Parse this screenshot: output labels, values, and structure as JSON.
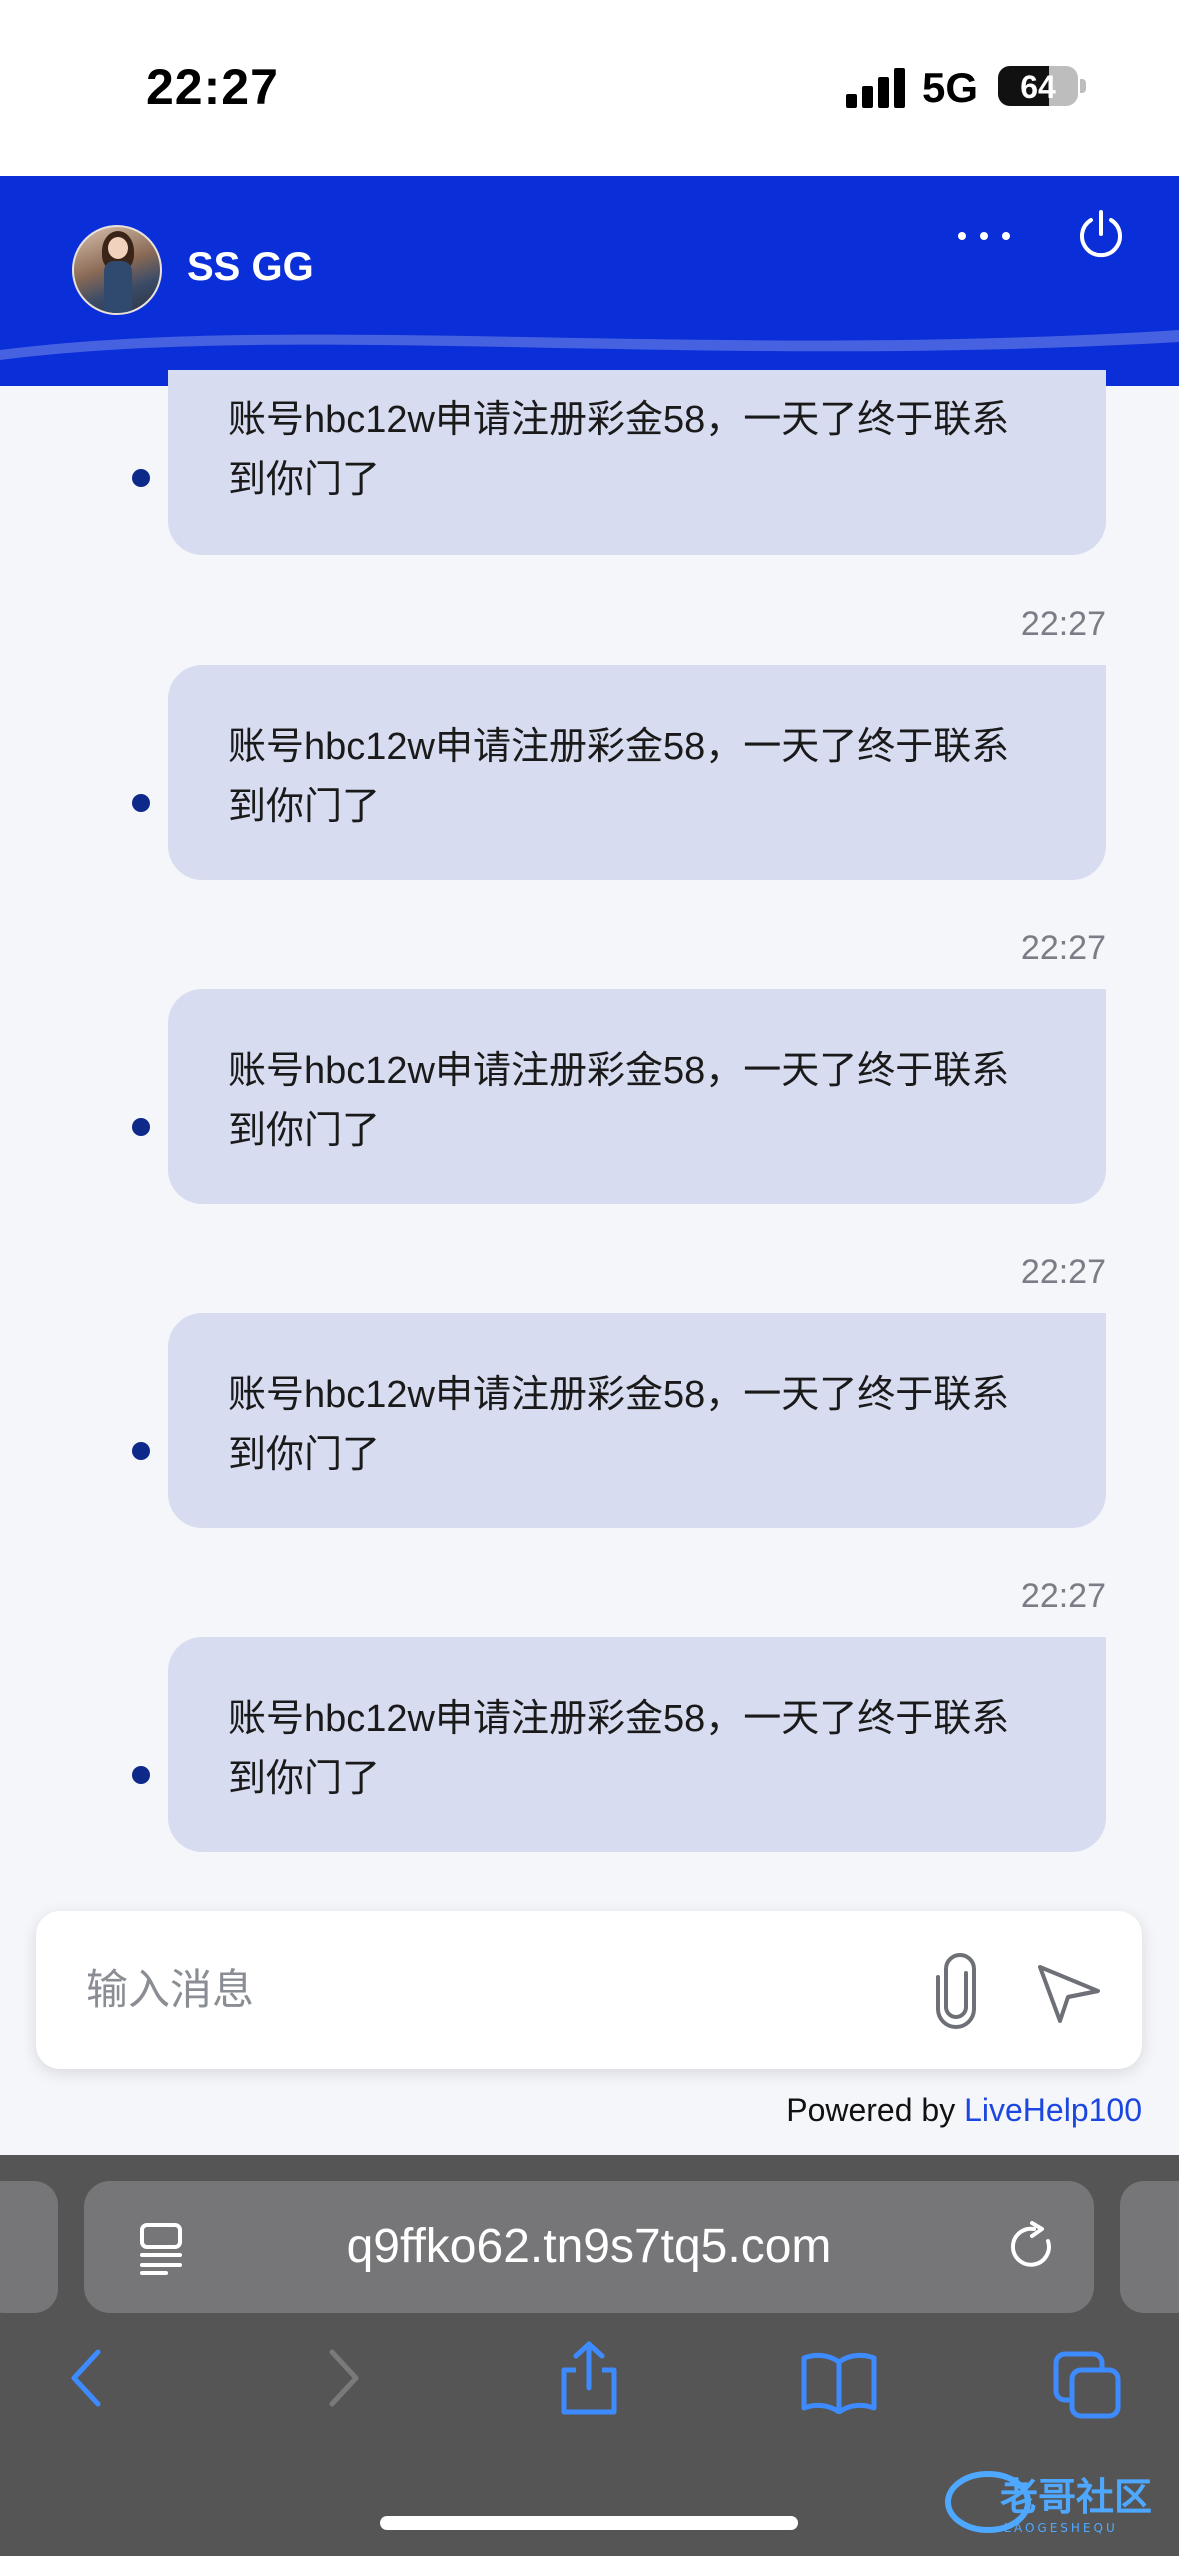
{
  "status_bar": {
    "time": "22:27",
    "network": "5G",
    "battery": "64",
    "battery_level": 0.64
  },
  "header": {
    "name": "SS GG",
    "avatar_icon": "user-avatar",
    "more_icon": "more-horizontal-icon",
    "power_icon": "power-icon",
    "color": "#0a2fd8"
  },
  "messages": [
    {
      "text": "账号hbc12w申请注册彩金58，一天了终于联系到你门了",
      "time": ""
    },
    {
      "text": "账号hbc12w申请注册彩金58，一天了终于联系到你门了",
      "time": "22:27"
    },
    {
      "text": "账号hbc12w申请注册彩金58，一天了终于联系到你门了",
      "time": "22:27"
    },
    {
      "text": "账号hbc12w申请注册彩金58，一天了终于联系到你门了",
      "time": "22:27"
    },
    {
      "text": "账号hbc12w申请注册彩金58，一天了终于联系到你门了",
      "time": "22:27"
    }
  ],
  "composer": {
    "placeholder": "输入消息",
    "attach_icon": "paperclip-icon",
    "send_icon": "send-icon"
  },
  "footer": {
    "powered_prefix": "Powered by ",
    "powered_link": "LiveHelp100"
  },
  "browser": {
    "url": "q9ffko62.tn9s7tq5.com",
    "icons": [
      "reader-icon",
      "reload-icon",
      "back-icon",
      "forward-icon",
      "share-icon",
      "bookmarks-icon",
      "tabs-icon"
    ]
  },
  "watermark": {
    "text": "老哥社区",
    "subtext": "LAOGESHEQU"
  }
}
